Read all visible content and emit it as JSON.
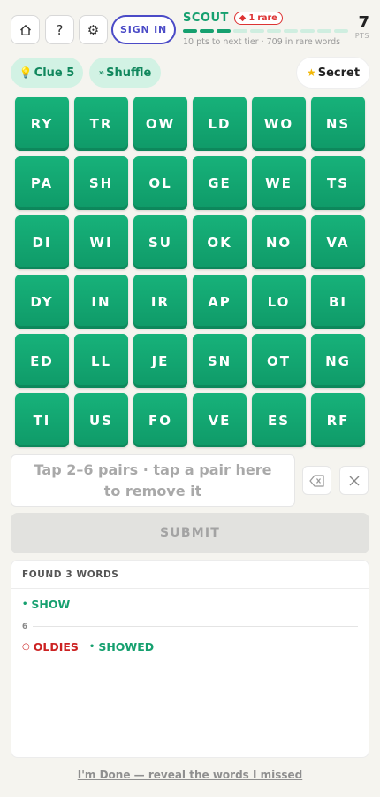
{
  "header": {
    "home_icon": "home-icon",
    "help_icon": "help-icon",
    "settings_icon": "gear-icon",
    "signin_label": "SIGN IN",
    "rank": "SCOUT",
    "rare_badge": "◆ 1 rare",
    "progress": {
      "filled": 3,
      "total": 10
    },
    "next_tier": "10 pts to next tier · 709 in rare words",
    "score": "7",
    "score_unit": "PTS"
  },
  "actions": {
    "clue_label": "Clue 5",
    "clue_icon": "lightbulb-icon",
    "shuffle_label": "Shuffle",
    "shuffle_icon": "shuffle-icon",
    "secret_label": "Secret",
    "secret_icon": "star-icon"
  },
  "tiles": [
    "RY",
    "TR",
    "OW",
    "LD",
    "WO",
    "NS",
    "PA",
    "SH",
    "OL",
    "GE",
    "WE",
    "TS",
    "DI",
    "WI",
    "SU",
    "OK",
    "NO",
    "VA",
    "DY",
    "IN",
    "IR",
    "AP",
    "LO",
    "BI",
    "ED",
    "LL",
    "JE",
    "SN",
    "OT",
    "NG",
    "TI",
    "US",
    "FO",
    "VE",
    "ES",
    "RF"
  ],
  "entry": {
    "placeholder": "Tap 2–6 pairs · tap a pair here to remove it",
    "backspace_icon": "backspace-icon",
    "clear_icon": "close-icon"
  },
  "submit_label": "SUBMIT",
  "found": {
    "heading": "FOUND 3 WORDS",
    "words_4": [
      {
        "word": "SHOW",
        "marker": "•",
        "type": "common"
      }
    ],
    "length_label": "6",
    "words_6": [
      {
        "word": "OLDIES",
        "marker": "○",
        "type": "rare"
      },
      {
        "word": "SHOWED",
        "marker": "•",
        "type": "common"
      }
    ]
  },
  "done_label": "I'm Done — reveal the words I missed",
  "colors": {
    "tile": "#12a872",
    "accent": "#16a06f",
    "rare": "#cc2222",
    "signin": "#4b4bc7",
    "background": "#f5f4ef"
  }
}
